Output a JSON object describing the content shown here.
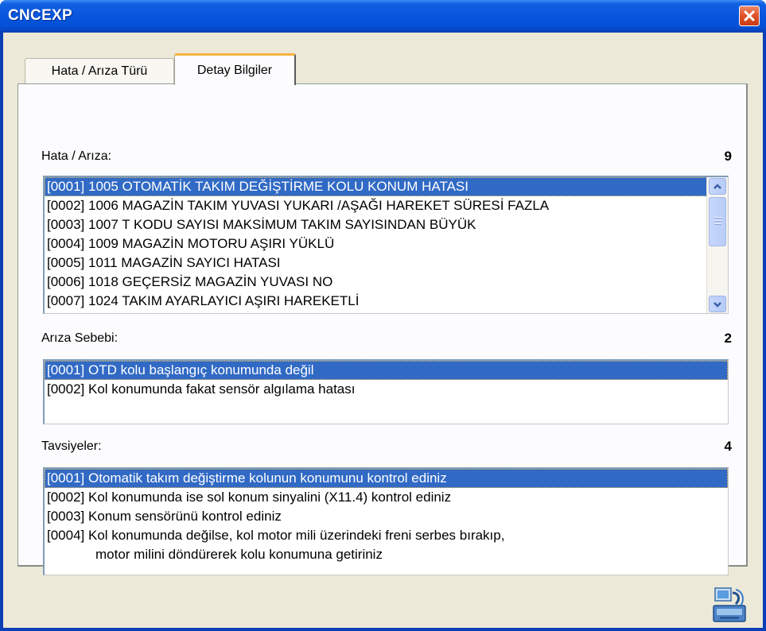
{
  "window": {
    "title": "CNCEXP"
  },
  "tabs": [
    {
      "label": "Hata / Arıza Türü",
      "active": false
    },
    {
      "label": "Detay Bilgiler",
      "active": true
    }
  ],
  "faults": {
    "label": "Hata / Arıza:",
    "count": "9",
    "items": [
      "[0001] 1005 OTOMATİK TAKIM DEĞİŞTİRME KOLU KONUM HATASI",
      "[0002] 1006 MAGAZİN TAKIM YUVASI YUKARI /AŞAĞI HAREKET SÜRESİ FAZLA",
      "[0003] 1007 T KODU SAYISI MAKSİMUM TAKIM SAYISINDAN BÜYÜK",
      "[0004] 1009 MAGAZİN MOTORU AŞIRI YÜKLÜ",
      "[0005] 1011 MAGAZİN SAYICI HATASI",
      "[0006] 1018 GEÇERSİZ MAGAZİN YUVASI NO",
      "[0007] 1024 TAKIM AYARLAYICI AŞIRI HAREKETLİ"
    ],
    "selected_index": 0
  },
  "causes": {
    "label": "Arıza Sebebi:",
    "count": "2",
    "items": [
      "[0001] OTD kolu başlangıç konumunda değil",
      "[0002] Kol konumunda fakat sensör algılama hatası"
    ],
    "selected_index": 0
  },
  "recommendations": {
    "label": "Tavsiyeler:",
    "count": "4",
    "items": [
      "[0001] Otomatik takım değiştirme kolunun konumunu kontrol ediniz",
      "[0002] Kol konumunda ise sol konum sinyalini (X11.4) kontrol ediniz",
      "[0003] Konum sensörünü kontrol ediniz",
      "[0004] Kol konumunda değilse, kol motor mili üzerindeki freni serbes bırakıp,",
      "motor milini döndürerek kolu konumuna getiriniz"
    ],
    "selected_index": 0
  },
  "colors": {
    "titlebar": "#0655dc",
    "selection": "#316ac5",
    "face": "#ece9d8",
    "close": "#e2552c"
  },
  "icons": [
    "close-icon",
    "scroll-up-icon",
    "scroll-down-icon",
    "computer-network-icon"
  ]
}
